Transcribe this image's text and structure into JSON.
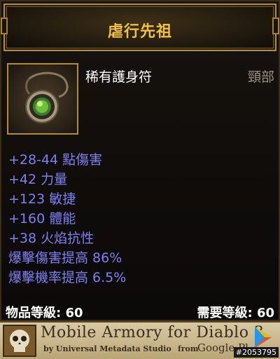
{
  "header": {
    "title": "虐行先祖"
  },
  "item": {
    "type": "稀有護身符",
    "slot": "頸部",
    "icon": "amulet-icon"
  },
  "stats": [
    "+28-44 點傷害",
    "+42 力量",
    "+123 敏捷",
    "+160 體能",
    "+38 火焰抗性",
    "爆擊傷害提高 86%",
    "爆擊機率提高 6.5%"
  ],
  "levels": {
    "item_level": "物品等級: 60",
    "required_level": "需要等級: 60"
  },
  "banner": {
    "title": "Mobile Armory for Diablo 3",
    "subtitle": "by Universal Metadata Studio",
    "from": "from",
    "google": "Google Pl",
    "watermark": "#2053795"
  },
  "colors": {
    "title": "#f0c045",
    "stat": "#7f7ff2",
    "gold_border": "#b38b33"
  }
}
